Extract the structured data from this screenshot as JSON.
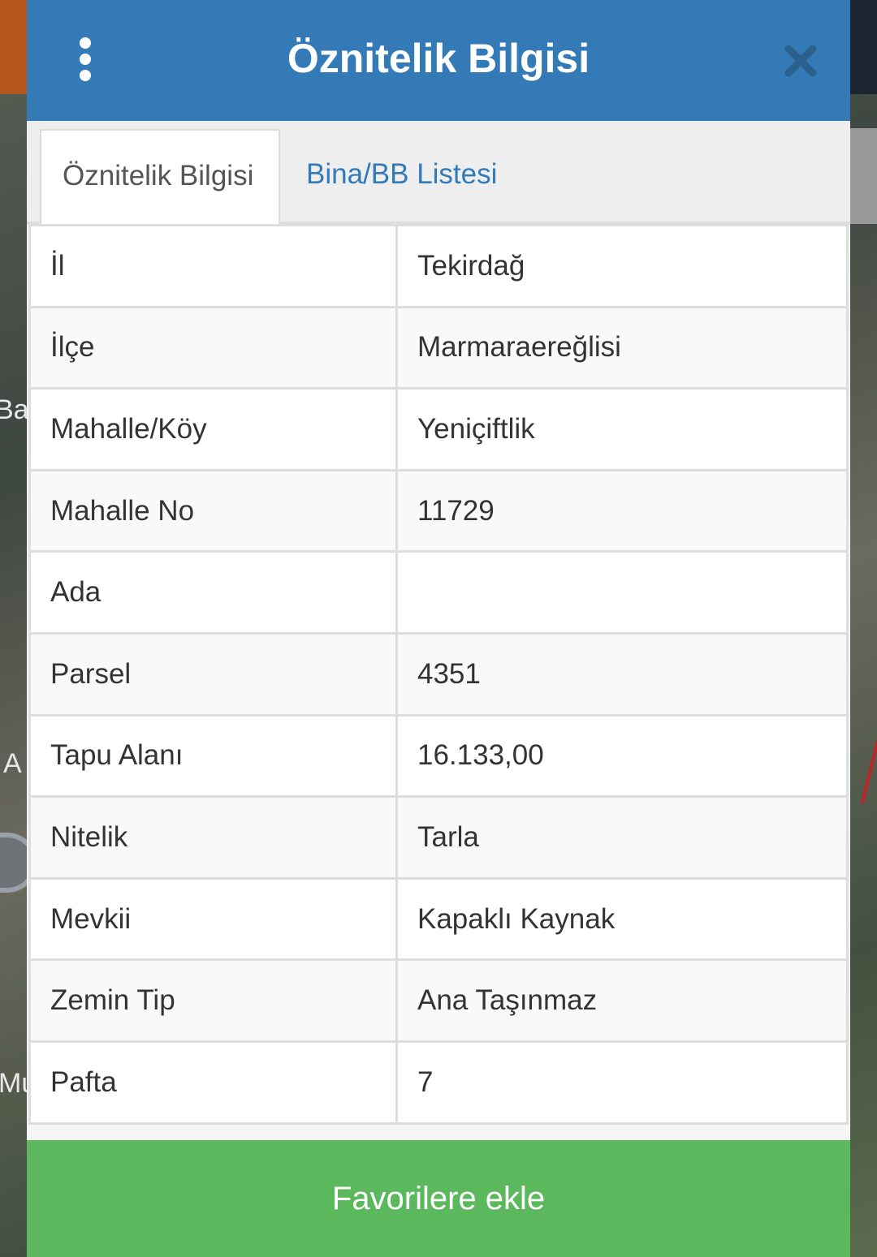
{
  "map": {
    "fragments": [
      "Ba",
      "A",
      "Mu"
    ]
  },
  "modal": {
    "title": "Öznitelik Bilgisi",
    "tabs": [
      {
        "label": "Öznitelik Bilgisi",
        "active": true
      },
      {
        "label": "Bina/BB Listesi",
        "active": false
      }
    ],
    "rows": [
      {
        "label": "İl",
        "value": "Tekirdağ"
      },
      {
        "label": "İlçe",
        "value": "Marmaraereğlisi"
      },
      {
        "label": "Mahalle/Köy",
        "value": "Yeniçiftlik"
      },
      {
        "label": "Mahalle No",
        "value": "11729"
      },
      {
        "label": "Ada",
        "value": ""
      },
      {
        "label": "Parsel",
        "value": "4351"
      },
      {
        "label": "Tapu Alanı",
        "value": "16.133,00"
      },
      {
        "label": "Nitelik",
        "value": "Tarla"
      },
      {
        "label": "Mevkii",
        "value": "Kapaklı Kaynak"
      },
      {
        "label": "Zemin Tip",
        "value": "Ana Taşınmaz"
      },
      {
        "label": "Pafta",
        "value": "7"
      }
    ],
    "favorite_button": "Favorilere ekle"
  },
  "colors": {
    "header": "#337ab7",
    "button": "#5cb85c",
    "close_icon": "#2b5f8c"
  },
  "icons": {
    "menu": "vertical-dots-icon",
    "close": "close-icon"
  }
}
